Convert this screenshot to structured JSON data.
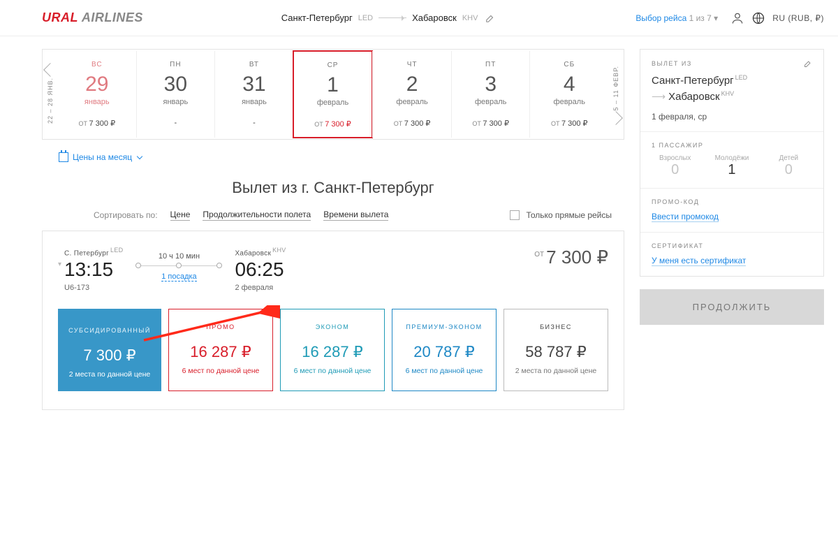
{
  "header": {
    "logo_ural": "URAL",
    "logo_airlines": "AIRLINES",
    "from_city": "Санкт-Петербург",
    "from_code": "LED",
    "to_city": "Хабаровск",
    "to_code": "KHV",
    "step_label": "Выбор рейса",
    "step_count": "1 из 7",
    "locale": "RU (RUB, ₽)"
  },
  "dates": {
    "prev_range": "22 – 28 ЯНВ.",
    "next_range": "5 – 11 ФЕВР.",
    "cells": [
      {
        "dow": "ВС",
        "num": "29",
        "month": "январь",
        "price": "7 300",
        "past": true
      },
      {
        "dow": "ПН",
        "num": "30",
        "month": "январь",
        "price": "-"
      },
      {
        "dow": "ВТ",
        "num": "31",
        "month": "январь",
        "price": "-"
      },
      {
        "dow": "СР",
        "num": "1",
        "month": "февраль",
        "price": "7 300",
        "selected": true
      },
      {
        "dow": "ЧТ",
        "num": "2",
        "month": "февраль",
        "price": "7 300"
      },
      {
        "dow": "ПТ",
        "num": "3",
        "month": "февраль",
        "price": "7 300"
      },
      {
        "dow": "СБ",
        "num": "4",
        "month": "февраль",
        "price": "7 300"
      }
    ],
    "month_prices_label": "Цены на месяц",
    "price_prefix": "ОТ"
  },
  "departure_title": "Вылет из г. Санкт-Петербург",
  "sort": {
    "label": "Сортировать по:",
    "opt_price": "Цене",
    "opt_duration": "Продолжительности полета",
    "opt_time": "Времени вылета",
    "direct_only": "Только прямые рейсы"
  },
  "flight": {
    "from_city": "С. Петербург",
    "from_code": "LED",
    "dep_time": "13:15",
    "flight_no": "U6-173",
    "duration": "10 ч 10 мин",
    "stops": "1 посадка",
    "to_city": "Хабаровск",
    "to_code": "KHV",
    "arr_time": "06:25",
    "arr_date": "2 февраля",
    "price_prefix": "ОТ",
    "price": "7 300"
  },
  "fares": [
    {
      "cls": "sub",
      "name": "СУБСИДИРОВАННЫЙ",
      "price": "7 300",
      "seats": "2 места по данной цене"
    },
    {
      "cls": "promo",
      "name": "ПРОМО",
      "price": "16 287",
      "seats": "6 мест по данной цене"
    },
    {
      "cls": "econ",
      "name": "ЭКОНОМ",
      "price": "16 287",
      "seats": "6 мест по данной цене"
    },
    {
      "cls": "prem",
      "name": "ПРЕМИУМ-ЭКОНОМ",
      "price": "20 787",
      "seats": "6 мест по данной цене"
    },
    {
      "cls": "biz",
      "name": "БИЗНЕС",
      "price": "58 787",
      "seats": "2 места по данной цене"
    }
  ],
  "sidebar": {
    "dep_label": "ВЫЛЕТ ИЗ",
    "from_city": "Санкт-Петербург",
    "from_code": "LED",
    "to_city": "Хабаровск",
    "to_code": "KHV",
    "date": "1 февраля, ср",
    "pax_label": "1 ПАССАЖИР",
    "pax": [
      {
        "label": "Взрослых",
        "val": "0"
      },
      {
        "label": "Молодёжи",
        "val": "1",
        "active": true
      },
      {
        "label": "Детей",
        "val": "0"
      }
    ],
    "promo_label": "ПРОМО-КОД",
    "promo_link": "Ввести промокод",
    "cert_label": "СЕРТИФИКАТ",
    "cert_link": "У меня есть сертификат",
    "continue": "ПРОДОЛЖИТЬ"
  }
}
